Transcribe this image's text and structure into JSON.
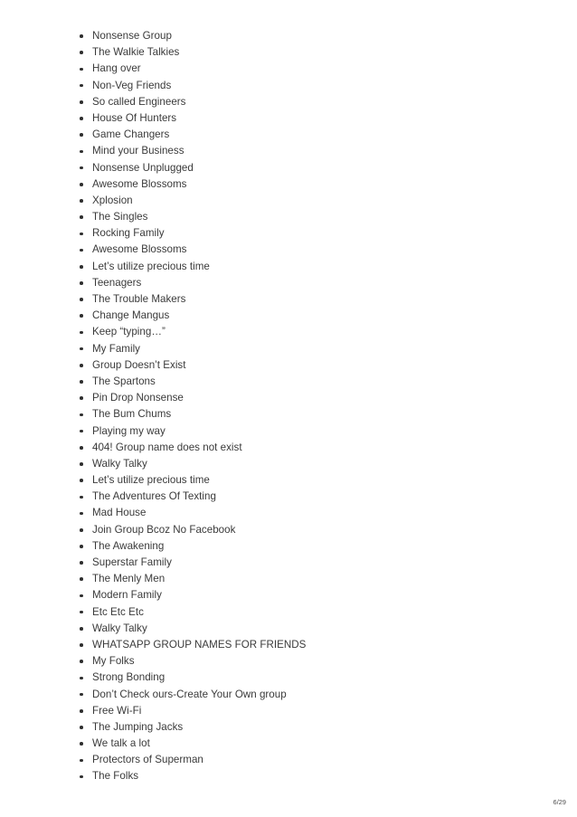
{
  "document": {
    "page_label": "6/29",
    "background_color": "#ffffff",
    "text_color": "#3a3a3a",
    "bullet_color": "#2f2f2f"
  },
  "list": {
    "marker": "bullet-disc",
    "items": [
      {
        "label": "Nonsense Group"
      },
      {
        "label": "The Walkie Talkies"
      },
      {
        "label": "Hang over"
      },
      {
        "label": "Non-Veg Friends"
      },
      {
        "label": "So called Engineers"
      },
      {
        "label": "House Of Hunters"
      },
      {
        "label": "Game Changers"
      },
      {
        "label": "Mind your Business"
      },
      {
        "label": "Nonsense Unplugged"
      },
      {
        "label": "Awesome Blossoms"
      },
      {
        "label": "Xplosion"
      },
      {
        "label": "The Singles"
      },
      {
        "label": "Rocking Family"
      },
      {
        "label": "Awesome Blossoms"
      },
      {
        "label": "Let’s utilize precious time"
      },
      {
        "label": "Teenagers"
      },
      {
        "label": "The Trouble Makers"
      },
      {
        "label": "Change Mangus"
      },
      {
        "label": "Keep “typing…”"
      },
      {
        "label": "My Family"
      },
      {
        "label": "Group Doesn’t Exist"
      },
      {
        "label": "The Spartons"
      },
      {
        "label": "Pin Drop Nonsense"
      },
      {
        "label": "The Bum Chums"
      },
      {
        "label": "Playing my way"
      },
      {
        "label": "404! Group name does not exist"
      },
      {
        "label": "Walky Talky"
      },
      {
        "label": "Let’s utilize precious time"
      },
      {
        "label": "The Adventures Of Texting"
      },
      {
        "label": "Mad House"
      },
      {
        "label": "Join Group Bcoz No Facebook"
      },
      {
        "label": "The Awakening"
      },
      {
        "label": "Superstar Family"
      },
      {
        "label": "The Menly Men"
      },
      {
        "label": "Modern Family"
      },
      {
        "label": "Etc Etc Etc"
      },
      {
        "label": "Walky Talky"
      },
      {
        "label": "WHATSAPP GROUP NAMES FOR FRIENDS"
      },
      {
        "label": "My Folks"
      },
      {
        "label": "Strong Bonding"
      },
      {
        "label": "Don’t Check ours-Create Your Own group"
      },
      {
        "label": "Free Wi-Fi"
      },
      {
        "label": "The Jumping Jacks"
      },
      {
        "label": "We talk a lot"
      },
      {
        "label": "Protectors of Superman"
      },
      {
        "label": "The Folks"
      }
    ]
  }
}
